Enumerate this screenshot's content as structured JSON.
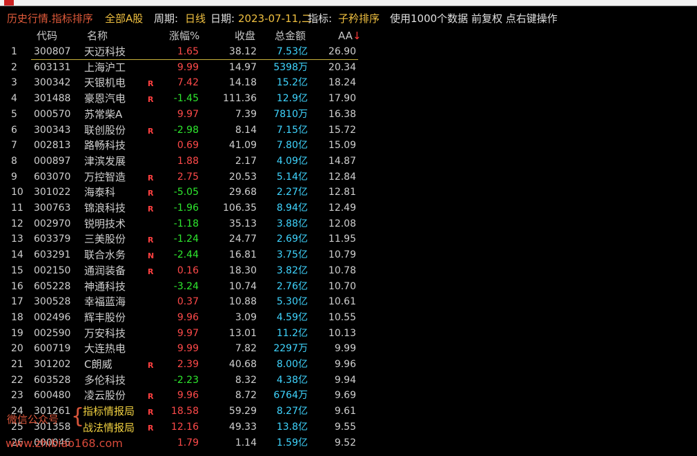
{
  "titlebar": {
    "title": "历史行情.指标排序",
    "market": "全部A股",
    "period_label": "周期:",
    "period_value": "日线",
    "date_label": "日期:",
    "date_value": "2023-07-11,二",
    "indicator_label": "指标:",
    "indicator_value": "子矜排序",
    "info": "使用1000个数据 前复权 点右键操作"
  },
  "columns": {
    "code": "代码",
    "name": "名称",
    "pct": "涨幅%",
    "close": "收盘",
    "amount": "总金额",
    "aa": "AA"
  },
  "colors": {
    "up": "#ff4a4a",
    "down": "#2ee82e",
    "amount": "#3fd5ff",
    "accent": "#f0c040"
  },
  "rows": [
    {
      "idx": "1",
      "code": "300807",
      "name": "天迈科技",
      "flag": "",
      "pct": "1.65",
      "close": "38.12",
      "amount": "7.53亿",
      "aa": "26.90"
    },
    {
      "idx": "2",
      "code": "603131",
      "name": "上海沪工",
      "flag": "",
      "pct": "9.99",
      "close": "14.97",
      "amount": "5398万",
      "aa": "20.34"
    },
    {
      "idx": "3",
      "code": "300342",
      "name": "天银机电",
      "flag": "R",
      "pct": "7.42",
      "close": "14.18",
      "amount": "15.2亿",
      "aa": "18.24"
    },
    {
      "idx": "4",
      "code": "301488",
      "name": "豪恩汽电",
      "flag": "R",
      "pct": "-1.45",
      "close": "111.36",
      "amount": "12.9亿",
      "aa": "17.90"
    },
    {
      "idx": "5",
      "code": "000570",
      "name": "苏常柴A",
      "flag": "",
      "pct": "9.97",
      "close": "7.39",
      "amount": "7810万",
      "aa": "16.38"
    },
    {
      "idx": "6",
      "code": "300343",
      "name": "联创股份",
      "flag": "R",
      "pct": "-2.98",
      "close": "8.14",
      "amount": "7.15亿",
      "aa": "15.72"
    },
    {
      "idx": "7",
      "code": "002813",
      "name": "路畅科技",
      "flag": "",
      "pct": "0.69",
      "close": "41.09",
      "amount": "7.80亿",
      "aa": "15.09"
    },
    {
      "idx": "8",
      "code": "000897",
      "name": "津滨发展",
      "flag": "",
      "pct": "1.88",
      "close": "2.17",
      "amount": "4.09亿",
      "aa": "14.87"
    },
    {
      "idx": "9",
      "code": "603070",
      "name": "万控智造",
      "flag": "R",
      "pct": "2.75",
      "close": "20.53",
      "amount": "5.14亿",
      "aa": "12.84"
    },
    {
      "idx": "10",
      "code": "301022",
      "name": "海泰科",
      "flag": "R",
      "pct": "-5.05",
      "close": "29.68",
      "amount": "2.27亿",
      "aa": "12.81"
    },
    {
      "idx": "11",
      "code": "300763",
      "name": "锦浪科技",
      "flag": "R",
      "pct": "-1.96",
      "close": "106.35",
      "amount": "8.94亿",
      "aa": "12.49"
    },
    {
      "idx": "12",
      "code": "002970",
      "name": "锐明技术",
      "flag": "",
      "pct": "-1.18",
      "close": "35.13",
      "amount": "3.88亿",
      "aa": "12.08"
    },
    {
      "idx": "13",
      "code": "603379",
      "name": "三美股份",
      "flag": "R",
      "pct": "-1.24",
      "close": "24.77",
      "amount": "2.69亿",
      "aa": "11.95"
    },
    {
      "idx": "14",
      "code": "603291",
      "name": "联合水务",
      "flag": "N",
      "pct": "-2.44",
      "close": "16.81",
      "amount": "3.75亿",
      "aa": "10.79"
    },
    {
      "idx": "15",
      "code": "002150",
      "name": "通润装备",
      "flag": "R",
      "pct": "0.16",
      "close": "18.30",
      "amount": "3.82亿",
      "aa": "10.78"
    },
    {
      "idx": "16",
      "code": "605228",
      "name": "神通科技",
      "flag": "",
      "pct": "-3.24",
      "close": "10.74",
      "amount": "2.76亿",
      "aa": "10.70"
    },
    {
      "idx": "17",
      "code": "300528",
      "name": "幸福蓝海",
      "flag": "",
      "pct": "0.37",
      "close": "10.88",
      "amount": "5.30亿",
      "aa": "10.61"
    },
    {
      "idx": "18",
      "code": "002496",
      "name": "辉丰股份",
      "flag": "",
      "pct": "9.96",
      "close": "3.09",
      "amount": "4.59亿",
      "aa": "10.55"
    },
    {
      "idx": "19",
      "code": "002590",
      "name": "万安科技",
      "flag": "",
      "pct": "9.97",
      "close": "13.01",
      "amount": "11.2亿",
      "aa": "10.13"
    },
    {
      "idx": "20",
      "code": "600719",
      "name": "大连热电",
      "flag": "",
      "pct": "9.99",
      "close": "7.82",
      "amount": "2297万",
      "aa": "9.99"
    },
    {
      "idx": "21",
      "code": "301202",
      "name": "C朗威",
      "flag": "R",
      "pct": "2.39",
      "close": "40.68",
      "amount": "8.00亿",
      "aa": "9.96"
    },
    {
      "idx": "22",
      "code": "603528",
      "name": "多伦科技",
      "flag": "",
      "pct": "-2.23",
      "close": "8.32",
      "amount": "4.38亿",
      "aa": "9.94"
    },
    {
      "idx": "23",
      "code": "600480",
      "name": "凌云股份",
      "flag": "R",
      "pct": "9.96",
      "close": "8.72",
      "amount": "6764万",
      "aa": "9.69"
    },
    {
      "idx": "24",
      "code": "301261",
      "name": "",
      "flag": "R",
      "pct": "18.58",
      "close": "59.29",
      "amount": "8.27亿",
      "aa": "9.61"
    },
    {
      "idx": "25",
      "code": "301358",
      "name": "",
      "flag": "R",
      "pct": "12.16",
      "close": "49.33",
      "amount": "13.8亿",
      "aa": "9.55"
    },
    {
      "idx": "26",
      "code": "000046",
      "name": "",
      "flag": "",
      "pct": "1.79",
      "close": "1.14",
      "amount": "1.59亿",
      "aa": "9.52"
    }
  ],
  "watermark": {
    "label": "微信公众号",
    "line1": "指标情报局",
    "line2": "战法情报局",
    "url": "www.zhibiao168.com"
  }
}
